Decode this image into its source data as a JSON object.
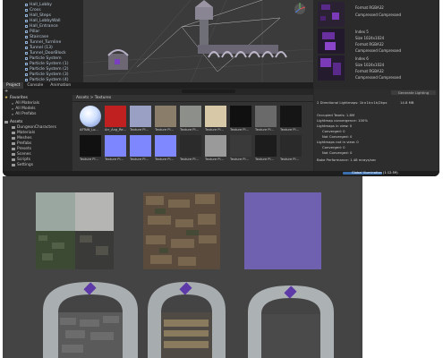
{
  "hierarchy": {
    "items": [
      "Hall_Lobby",
      "Cross",
      "Hall_Steps",
      "Hall_LobbyWall",
      "Hall_Entrance",
      "Pillar",
      "Staircase",
      "Tunnel_Turnline",
      "Tunnel (13)",
      "Tunnel_DoorBlock",
      "Particle System",
      "Particle System (1)",
      "Particle System (2)",
      "Particle System (3)",
      "Particle System (4)"
    ]
  },
  "bottom_tabs": [
    "Project",
    "Console",
    "Animation"
  ],
  "favorites": {
    "header": "Favorites",
    "items": [
      "All Materials",
      "All Models",
      "All Prefabs"
    ]
  },
  "assets_tree": {
    "header": "Assets",
    "items": [
      "DungeonCharacters",
      "Materials",
      "Meshes",
      "Prefabs",
      "Presets",
      "Scenes",
      "Scripts",
      "Settings"
    ]
  },
  "asset_path": "Assets > Textures",
  "assets": [
    {
      "label": "AFTsW_Lo...",
      "kind": "sphere",
      "color": "#cfe0ff"
    },
    {
      "label": "Arr_Ang_Re...",
      "kind": "flat",
      "color": "#c02020"
    },
    {
      "label": "Texture Pl...",
      "kind": "flat",
      "color": "#9aa0c4"
    },
    {
      "label": "Texture Pl...",
      "kind": "flat",
      "color": "#8a7d6a"
    },
    {
      "label": "Texture Pl...",
      "kind": "flat",
      "color": "#8d8f8a"
    },
    {
      "label": "Texture Pl...",
      "kind": "flat",
      "color": "#d7c9a8"
    },
    {
      "label": "Texture Pl...",
      "kind": "flat",
      "color": "#101010"
    },
    {
      "label": "Texture Pl...",
      "kind": "flat",
      "color": "#6a6a6a"
    },
    {
      "label": "Texture Pl...",
      "kind": "flat",
      "color": "#151515"
    },
    {
      "label": "Texture Pl...",
      "kind": "flat",
      "color": "#111111"
    },
    {
      "label": "Texture Pl...",
      "kind": "flat",
      "color": "#7d86ff"
    },
    {
      "label": "Texture Pl...",
      "kind": "flat",
      "color": "#7f87ff"
    },
    {
      "label": "Texture Pl...",
      "kind": "flat",
      "color": "#8088ff"
    },
    {
      "label": "Texture Pl...",
      "kind": "flat",
      "color": "#2b2b2b"
    },
    {
      "label": "Texture Pl...",
      "kind": "flat",
      "color": "#9a9a9a"
    },
    {
      "label": "Texture Pl...",
      "kind": "flat",
      "color": "#3a3a3a"
    },
    {
      "label": "Texture Pl...",
      "kind": "flat",
      "color": "#1c1c1c"
    },
    {
      "label": "Texture Pl...",
      "kind": "flat",
      "color": "#2a2a2a"
    }
  ],
  "inspector": {
    "entries": [
      {
        "lines": [
          "Format RGBA32",
          "Compressed Compressed"
        ]
      },
      {
        "lines": [
          "Index 5",
          "Size 1024x1024",
          "Format RGBA32",
          "Compressed Compressed"
        ]
      },
      {
        "lines": [
          "Index 6",
          "Size 1024x1024",
          "Format RGBA32",
          "Compressed Compressed"
        ]
      }
    ]
  },
  "lighting": {
    "button": "Generate Lighting",
    "rows": [
      "2 Directional Lightmaps: 1k×1k×1k/2kpx",
      "Occupied Texels: 1.8M",
      "Lightmap convergence: 100%",
      "Lightmaps in view: 0",
      "Converged: 0",
      "Not Converged: 0",
      "Lightmaps not in view: 0",
      "Converged: 0",
      "Not Converged: 0",
      "Bake Performance: 1.48 mrays/sec"
    ],
    "size_label": "14.8 MB"
  },
  "status": {
    "text": "Global Illumination (1:12:59)"
  },
  "lower_preview": {
    "description_visible": false
  }
}
